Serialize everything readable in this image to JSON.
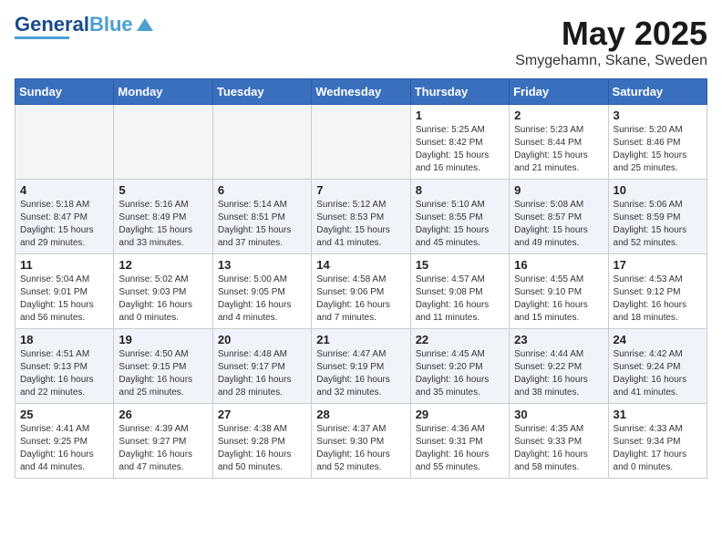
{
  "header": {
    "logo_line1": "General",
    "logo_line2": "Blue",
    "month": "May 2025",
    "location": "Smygehamn, Skane, Sweden"
  },
  "days_of_week": [
    "Sunday",
    "Monday",
    "Tuesday",
    "Wednesday",
    "Thursday",
    "Friday",
    "Saturday"
  ],
  "weeks": [
    [
      {
        "day": "",
        "info": ""
      },
      {
        "day": "",
        "info": ""
      },
      {
        "day": "",
        "info": ""
      },
      {
        "day": "",
        "info": ""
      },
      {
        "day": "1",
        "info": "Sunrise: 5:25 AM\nSunset: 8:42 PM\nDaylight: 15 hours\nand 16 minutes."
      },
      {
        "day": "2",
        "info": "Sunrise: 5:23 AM\nSunset: 8:44 PM\nDaylight: 15 hours\nand 21 minutes."
      },
      {
        "day": "3",
        "info": "Sunrise: 5:20 AM\nSunset: 8:46 PM\nDaylight: 15 hours\nand 25 minutes."
      }
    ],
    [
      {
        "day": "4",
        "info": "Sunrise: 5:18 AM\nSunset: 8:47 PM\nDaylight: 15 hours\nand 29 minutes."
      },
      {
        "day": "5",
        "info": "Sunrise: 5:16 AM\nSunset: 8:49 PM\nDaylight: 15 hours\nand 33 minutes."
      },
      {
        "day": "6",
        "info": "Sunrise: 5:14 AM\nSunset: 8:51 PM\nDaylight: 15 hours\nand 37 minutes."
      },
      {
        "day": "7",
        "info": "Sunrise: 5:12 AM\nSunset: 8:53 PM\nDaylight: 15 hours\nand 41 minutes."
      },
      {
        "day": "8",
        "info": "Sunrise: 5:10 AM\nSunset: 8:55 PM\nDaylight: 15 hours\nand 45 minutes."
      },
      {
        "day": "9",
        "info": "Sunrise: 5:08 AM\nSunset: 8:57 PM\nDaylight: 15 hours\nand 49 minutes."
      },
      {
        "day": "10",
        "info": "Sunrise: 5:06 AM\nSunset: 8:59 PM\nDaylight: 15 hours\nand 52 minutes."
      }
    ],
    [
      {
        "day": "11",
        "info": "Sunrise: 5:04 AM\nSunset: 9:01 PM\nDaylight: 15 hours\nand 56 minutes."
      },
      {
        "day": "12",
        "info": "Sunrise: 5:02 AM\nSunset: 9:03 PM\nDaylight: 16 hours\nand 0 minutes."
      },
      {
        "day": "13",
        "info": "Sunrise: 5:00 AM\nSunset: 9:05 PM\nDaylight: 16 hours\nand 4 minutes."
      },
      {
        "day": "14",
        "info": "Sunrise: 4:58 AM\nSunset: 9:06 PM\nDaylight: 16 hours\nand 7 minutes."
      },
      {
        "day": "15",
        "info": "Sunrise: 4:57 AM\nSunset: 9:08 PM\nDaylight: 16 hours\nand 11 minutes."
      },
      {
        "day": "16",
        "info": "Sunrise: 4:55 AM\nSunset: 9:10 PM\nDaylight: 16 hours\nand 15 minutes."
      },
      {
        "day": "17",
        "info": "Sunrise: 4:53 AM\nSunset: 9:12 PM\nDaylight: 16 hours\nand 18 minutes."
      }
    ],
    [
      {
        "day": "18",
        "info": "Sunrise: 4:51 AM\nSunset: 9:13 PM\nDaylight: 16 hours\nand 22 minutes."
      },
      {
        "day": "19",
        "info": "Sunrise: 4:50 AM\nSunset: 9:15 PM\nDaylight: 16 hours\nand 25 minutes."
      },
      {
        "day": "20",
        "info": "Sunrise: 4:48 AM\nSunset: 9:17 PM\nDaylight: 16 hours\nand 28 minutes."
      },
      {
        "day": "21",
        "info": "Sunrise: 4:47 AM\nSunset: 9:19 PM\nDaylight: 16 hours\nand 32 minutes."
      },
      {
        "day": "22",
        "info": "Sunrise: 4:45 AM\nSunset: 9:20 PM\nDaylight: 16 hours\nand 35 minutes."
      },
      {
        "day": "23",
        "info": "Sunrise: 4:44 AM\nSunset: 9:22 PM\nDaylight: 16 hours\nand 38 minutes."
      },
      {
        "day": "24",
        "info": "Sunrise: 4:42 AM\nSunset: 9:24 PM\nDaylight: 16 hours\nand 41 minutes."
      }
    ],
    [
      {
        "day": "25",
        "info": "Sunrise: 4:41 AM\nSunset: 9:25 PM\nDaylight: 16 hours\nand 44 minutes."
      },
      {
        "day": "26",
        "info": "Sunrise: 4:39 AM\nSunset: 9:27 PM\nDaylight: 16 hours\nand 47 minutes."
      },
      {
        "day": "27",
        "info": "Sunrise: 4:38 AM\nSunset: 9:28 PM\nDaylight: 16 hours\nand 50 minutes."
      },
      {
        "day": "28",
        "info": "Sunrise: 4:37 AM\nSunset: 9:30 PM\nDaylight: 16 hours\nand 52 minutes."
      },
      {
        "day": "29",
        "info": "Sunrise: 4:36 AM\nSunset: 9:31 PM\nDaylight: 16 hours\nand 55 minutes."
      },
      {
        "day": "30",
        "info": "Sunrise: 4:35 AM\nSunset: 9:33 PM\nDaylight: 16 hours\nand 58 minutes."
      },
      {
        "day": "31",
        "info": "Sunrise: 4:33 AM\nSunset: 9:34 PM\nDaylight: 17 hours\nand 0 minutes."
      }
    ]
  ]
}
